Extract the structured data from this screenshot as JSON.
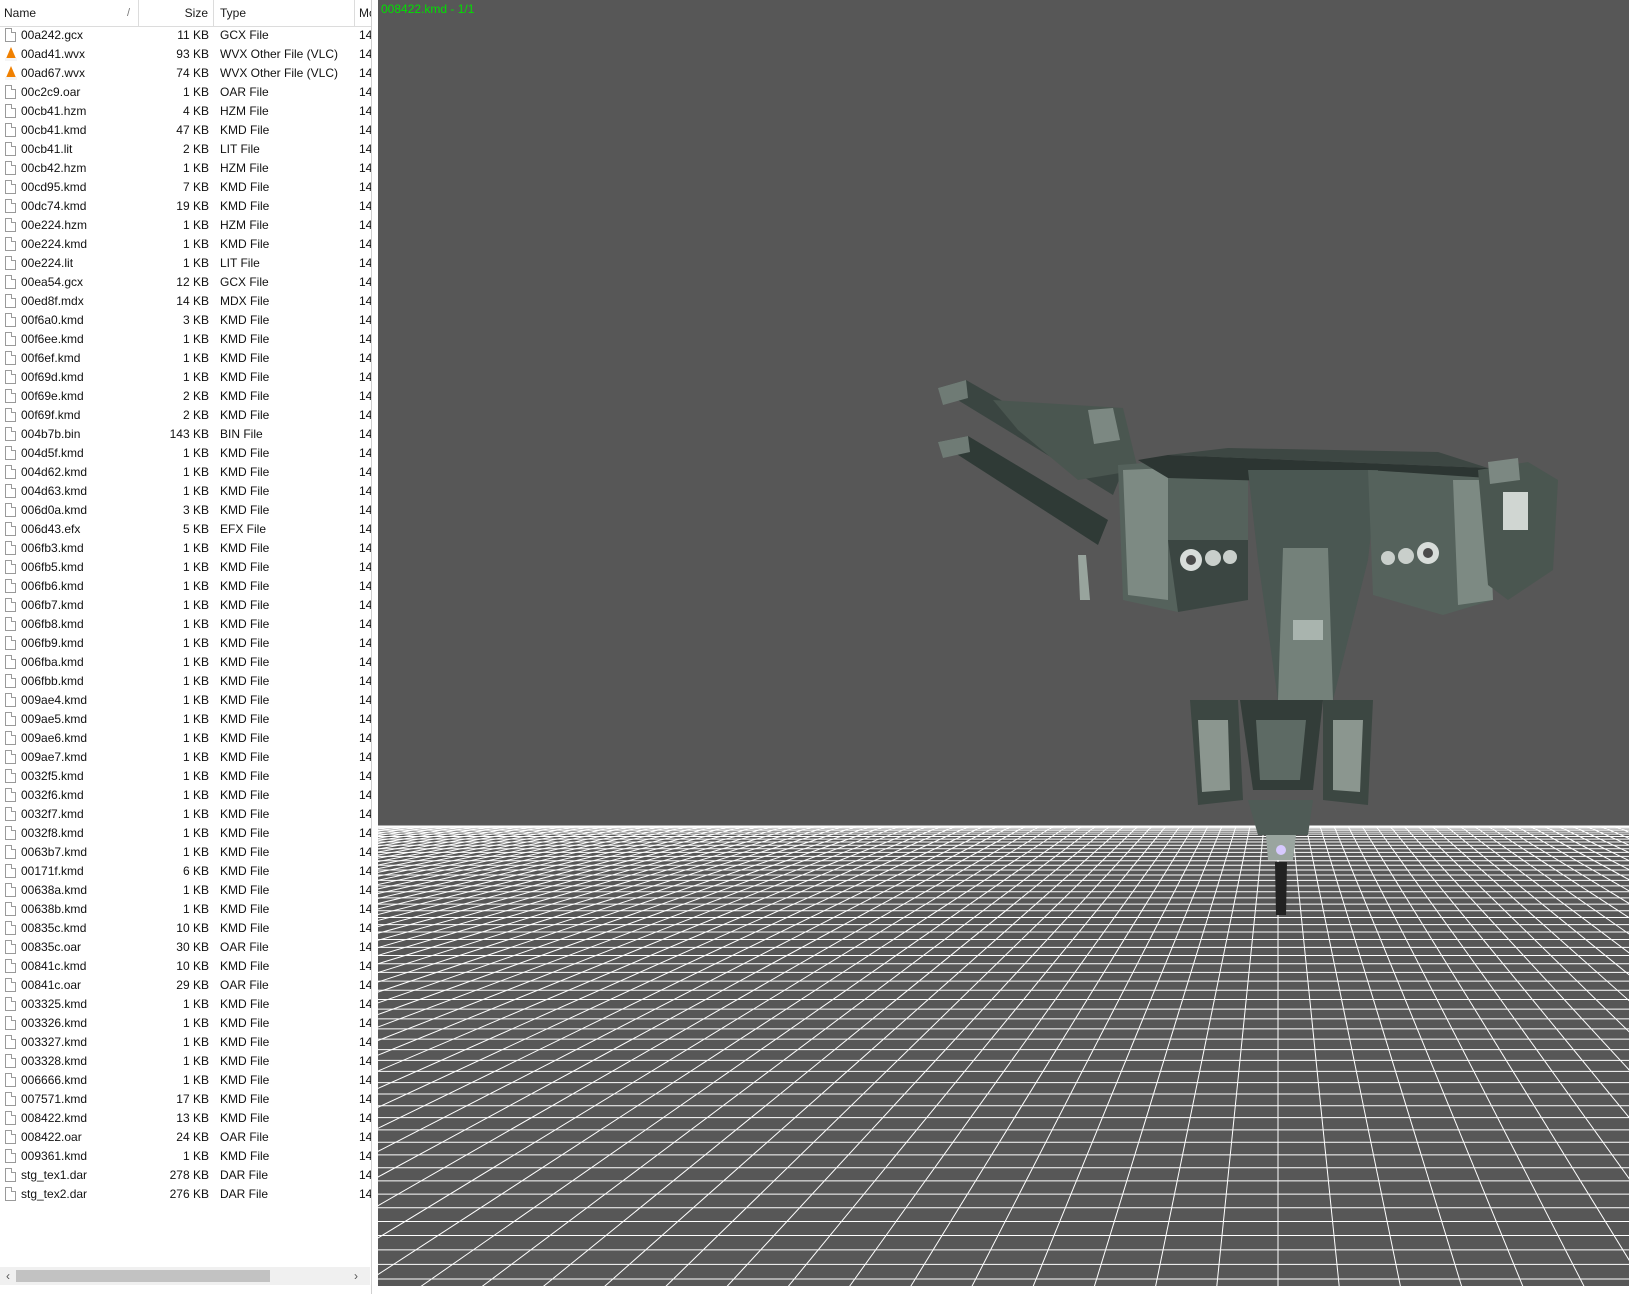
{
  "explorer": {
    "columns": {
      "name": "Name",
      "sort_glyph": "/",
      "size": "Size",
      "type": "Type",
      "modified": "Mo"
    },
    "files": [
      {
        "name": "00a242.gcx",
        "size": "11 KB",
        "type": "GCX File",
        "modified": "14",
        "icon": "file-icon"
      },
      {
        "name": "00ad41.wvx",
        "size": "93 KB",
        "type": "WVX Other File (VLC)",
        "modified": "14",
        "icon": "vlc-icon"
      },
      {
        "name": "00ad67.wvx",
        "size": "74 KB",
        "type": "WVX Other File (VLC)",
        "modified": "14",
        "icon": "vlc-icon"
      },
      {
        "name": "00c2c9.oar",
        "size": "1 KB",
        "type": "OAR File",
        "modified": "14",
        "icon": "file-icon"
      },
      {
        "name": "00cb41.hzm",
        "size": "4 KB",
        "type": "HZM File",
        "modified": "14",
        "icon": "file-icon"
      },
      {
        "name": "00cb41.kmd",
        "size": "47 KB",
        "type": "KMD File",
        "modified": "14",
        "icon": "file-icon"
      },
      {
        "name": "00cb41.lit",
        "size": "2 KB",
        "type": "LIT File",
        "modified": "14",
        "icon": "file-icon"
      },
      {
        "name": "00cb42.hzm",
        "size": "1 KB",
        "type": "HZM File",
        "modified": "14",
        "icon": "file-icon"
      },
      {
        "name": "00cd95.kmd",
        "size": "7 KB",
        "type": "KMD File",
        "modified": "14",
        "icon": "file-icon"
      },
      {
        "name": "00dc74.kmd",
        "size": "19 KB",
        "type": "KMD File",
        "modified": "14",
        "icon": "file-icon"
      },
      {
        "name": "00e224.hzm",
        "size": "1 KB",
        "type": "HZM File",
        "modified": "14",
        "icon": "file-icon"
      },
      {
        "name": "00e224.kmd",
        "size": "1 KB",
        "type": "KMD File",
        "modified": "14",
        "icon": "file-icon"
      },
      {
        "name": "00e224.lit",
        "size": "1 KB",
        "type": "LIT File",
        "modified": "14",
        "icon": "file-icon"
      },
      {
        "name": "00ea54.gcx",
        "size": "12 KB",
        "type": "GCX File",
        "modified": "14",
        "icon": "file-icon"
      },
      {
        "name": "00ed8f.mdx",
        "size": "14 KB",
        "type": "MDX File",
        "modified": "14",
        "icon": "file-icon"
      },
      {
        "name": "00f6a0.kmd",
        "size": "3 KB",
        "type": "KMD File",
        "modified": "14",
        "icon": "file-icon"
      },
      {
        "name": "00f6ee.kmd",
        "size": "1 KB",
        "type": "KMD File",
        "modified": "14",
        "icon": "file-icon"
      },
      {
        "name": "00f6ef.kmd",
        "size": "1 KB",
        "type": "KMD File",
        "modified": "14",
        "icon": "file-icon"
      },
      {
        "name": "00f69d.kmd",
        "size": "1 KB",
        "type": "KMD File",
        "modified": "14",
        "icon": "file-icon"
      },
      {
        "name": "00f69e.kmd",
        "size": "2 KB",
        "type": "KMD File",
        "modified": "14",
        "icon": "file-icon"
      },
      {
        "name": "00f69f.kmd",
        "size": "2 KB",
        "type": "KMD File",
        "modified": "14",
        "icon": "file-icon"
      },
      {
        "name": "004b7b.bin",
        "size": "143 KB",
        "type": "BIN File",
        "modified": "14",
        "icon": "file-icon"
      },
      {
        "name": "004d5f.kmd",
        "size": "1 KB",
        "type": "KMD File",
        "modified": "14",
        "icon": "file-icon"
      },
      {
        "name": "004d62.kmd",
        "size": "1 KB",
        "type": "KMD File",
        "modified": "14",
        "icon": "file-icon"
      },
      {
        "name": "004d63.kmd",
        "size": "1 KB",
        "type": "KMD File",
        "modified": "14",
        "icon": "file-icon"
      },
      {
        "name": "006d0a.kmd",
        "size": "3 KB",
        "type": "KMD File",
        "modified": "14",
        "icon": "file-icon"
      },
      {
        "name": "006d43.efx",
        "size": "5 KB",
        "type": "EFX File",
        "modified": "14",
        "icon": "file-icon"
      },
      {
        "name": "006fb3.kmd",
        "size": "1 KB",
        "type": "KMD File",
        "modified": "14",
        "icon": "file-icon"
      },
      {
        "name": "006fb5.kmd",
        "size": "1 KB",
        "type": "KMD File",
        "modified": "14",
        "icon": "file-icon"
      },
      {
        "name": "006fb6.kmd",
        "size": "1 KB",
        "type": "KMD File",
        "modified": "14",
        "icon": "file-icon"
      },
      {
        "name": "006fb7.kmd",
        "size": "1 KB",
        "type": "KMD File",
        "modified": "14",
        "icon": "file-icon"
      },
      {
        "name": "006fb8.kmd",
        "size": "1 KB",
        "type": "KMD File",
        "modified": "14",
        "icon": "file-icon"
      },
      {
        "name": "006fb9.kmd",
        "size": "1 KB",
        "type": "KMD File",
        "modified": "14",
        "icon": "file-icon"
      },
      {
        "name": "006fba.kmd",
        "size": "1 KB",
        "type": "KMD File",
        "modified": "14",
        "icon": "file-icon"
      },
      {
        "name": "006fbb.kmd",
        "size": "1 KB",
        "type": "KMD File",
        "modified": "14",
        "icon": "file-icon"
      },
      {
        "name": "009ae4.kmd",
        "size": "1 KB",
        "type": "KMD File",
        "modified": "14",
        "icon": "file-icon"
      },
      {
        "name": "009ae5.kmd",
        "size": "1 KB",
        "type": "KMD File",
        "modified": "14",
        "icon": "file-icon"
      },
      {
        "name": "009ae6.kmd",
        "size": "1 KB",
        "type": "KMD File",
        "modified": "14",
        "icon": "file-icon"
      },
      {
        "name": "009ae7.kmd",
        "size": "1 KB",
        "type": "KMD File",
        "modified": "14",
        "icon": "file-icon"
      },
      {
        "name": "0032f5.kmd",
        "size": "1 KB",
        "type": "KMD File",
        "modified": "14",
        "icon": "file-icon"
      },
      {
        "name": "0032f6.kmd",
        "size": "1 KB",
        "type": "KMD File",
        "modified": "14",
        "icon": "file-icon"
      },
      {
        "name": "0032f7.kmd",
        "size": "1 KB",
        "type": "KMD File",
        "modified": "14",
        "icon": "file-icon"
      },
      {
        "name": "0032f8.kmd",
        "size": "1 KB",
        "type": "KMD File",
        "modified": "14",
        "icon": "file-icon"
      },
      {
        "name": "0063b7.kmd",
        "size": "1 KB",
        "type": "KMD File",
        "modified": "14",
        "icon": "file-icon"
      },
      {
        "name": "00171f.kmd",
        "size": "6 KB",
        "type": "KMD File",
        "modified": "14",
        "icon": "file-icon"
      },
      {
        "name": "00638a.kmd",
        "size": "1 KB",
        "type": "KMD File",
        "modified": "14",
        "icon": "file-icon"
      },
      {
        "name": "00638b.kmd",
        "size": "1 KB",
        "type": "KMD File",
        "modified": "14",
        "icon": "file-icon"
      },
      {
        "name": "00835c.kmd",
        "size": "10 KB",
        "type": "KMD File",
        "modified": "14",
        "icon": "file-icon"
      },
      {
        "name": "00835c.oar",
        "size": "30 KB",
        "type": "OAR File",
        "modified": "14",
        "icon": "file-icon"
      },
      {
        "name": "00841c.kmd",
        "size": "10 KB",
        "type": "KMD File",
        "modified": "14",
        "icon": "file-icon"
      },
      {
        "name": "00841c.oar",
        "size": "29 KB",
        "type": "OAR File",
        "modified": "14",
        "icon": "file-icon"
      },
      {
        "name": "003325.kmd",
        "size": "1 KB",
        "type": "KMD File",
        "modified": "14",
        "icon": "file-icon"
      },
      {
        "name": "003326.kmd",
        "size": "1 KB",
        "type": "KMD File",
        "modified": "14",
        "icon": "file-icon"
      },
      {
        "name": "003327.kmd",
        "size": "1 KB",
        "type": "KMD File",
        "modified": "14",
        "icon": "file-icon"
      },
      {
        "name": "003328.kmd",
        "size": "1 KB",
        "type": "KMD File",
        "modified": "14",
        "icon": "file-icon"
      },
      {
        "name": "006666.kmd",
        "size": "1 KB",
        "type": "KMD File",
        "modified": "14",
        "icon": "file-icon"
      },
      {
        "name": "007571.kmd",
        "size": "17 KB",
        "type": "KMD File",
        "modified": "14",
        "icon": "file-icon"
      },
      {
        "name": "008422.kmd",
        "size": "13 KB",
        "type": "KMD File",
        "modified": "14",
        "icon": "file-icon"
      },
      {
        "name": "008422.oar",
        "size": "24 KB",
        "type": "OAR File",
        "modified": "14",
        "icon": "file-icon"
      },
      {
        "name": "009361.kmd",
        "size": "1 KB",
        "type": "KMD File",
        "modified": "14",
        "icon": "file-icon"
      },
      {
        "name": "stg_tex1.dar",
        "size": "278 KB",
        "type": "DAR File",
        "modified": "14",
        "icon": "file-icon"
      },
      {
        "name": "stg_tex2.dar",
        "size": "276 KB",
        "type": "DAR File",
        "modified": "14",
        "icon": "file-icon"
      }
    ],
    "scrollbar": {
      "left_arrow": "‹",
      "right_arrow": "›"
    }
  },
  "viewer": {
    "status": "008422.kmd - 1/1",
    "colors": {
      "background": "#575757",
      "grid": "#ffffff",
      "status_text": "#00e000",
      "model_dark": "#2a3430",
      "model_mid": "#4f5c56",
      "model_light": "#8e9a94"
    }
  }
}
